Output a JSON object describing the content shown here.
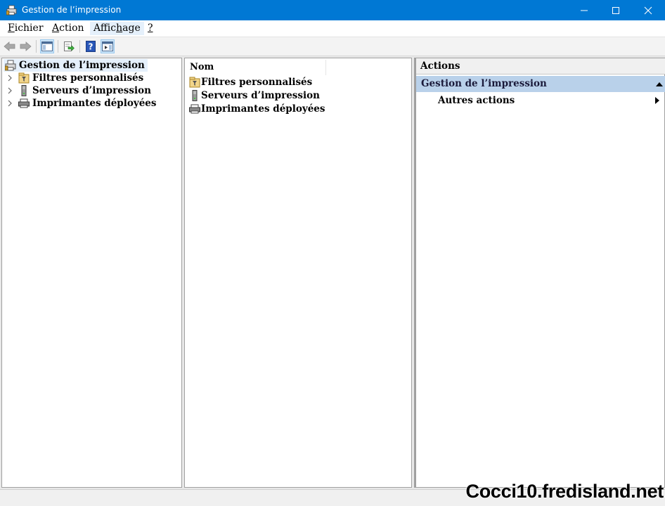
{
  "window": {
    "title": "Gestion de l’impression"
  },
  "menu": [
    {
      "before": "",
      "mnemonic": "F",
      "after": "ichier"
    },
    {
      "before": "",
      "mnemonic": "A",
      "after": "ction"
    },
    {
      "before": "Affic",
      "mnemonic": "h",
      "after": "age"
    },
    {
      "before": "",
      "mnemonic": "?",
      "after": ""
    }
  ],
  "tree": {
    "root": "Gestion de l’impression",
    "children": [
      "Filtres personnalisés",
      "Serveurs d’impression",
      "Imprimantes déployées"
    ]
  },
  "list": {
    "column_header": "Nom",
    "items": [
      "Filtres personnalisés",
      "Serveurs d’impression",
      "Imprimantes déployées"
    ]
  },
  "actions": {
    "header": "Actions",
    "section": "Gestion de l’impression",
    "item": "Autres actions"
  },
  "watermark": "Cocci10.fredisland.net",
  "colors": {
    "titlebar": "#0078d4",
    "selection": "#e5f0fb",
    "actions_section": "#b9d1ea"
  }
}
